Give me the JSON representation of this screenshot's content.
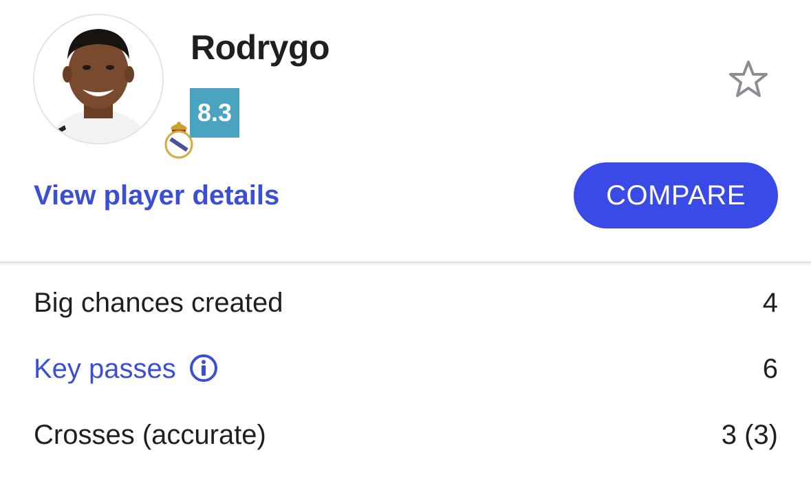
{
  "player": {
    "name": "Rodrygo",
    "rating": "8.3"
  },
  "actions": {
    "details_link": "View player details",
    "compare_label": "COMPARE",
    "favorite_icon": "star-outline-icon"
  },
  "stats": [
    {
      "label": "Big chances created",
      "value": "4"
    },
    {
      "label": "Key passes",
      "value": "6"
    },
    {
      "label": "Crosses (accurate)",
      "value": "3 (3)"
    }
  ],
  "colors": {
    "accent": "#3a4ae6",
    "link": "#3b4fd6",
    "rating_bg": "#4aa3bf"
  }
}
